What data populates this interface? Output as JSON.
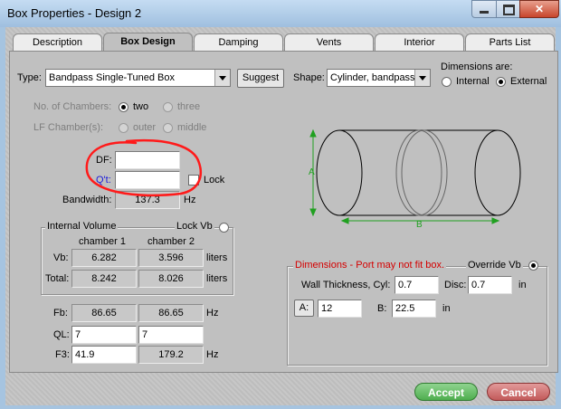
{
  "window": {
    "title": "Box Properties - Design 2",
    "close_glyph": "✕"
  },
  "tabs": [
    "Description",
    "Box Design",
    "Damping",
    "Vents",
    "Interior",
    "Parts List"
  ],
  "type": {
    "label": "Type:",
    "value": "Bandpass Single-Tuned Box",
    "suggest_label": "Suggest"
  },
  "shape": {
    "label": "Shape:",
    "value": "Cylinder, bandpass"
  },
  "dimensions_are": {
    "label": "Dimensions are:",
    "internal": "Internal",
    "external": "External",
    "selected": "External"
  },
  "chambers": {
    "label": "No. of Chambers:",
    "two": "two",
    "three": "three",
    "selected": "two"
  },
  "lf_chamber": {
    "label": "LF Chamber(s):",
    "outer": "outer",
    "middle": "middle"
  },
  "df": {
    "label": "DF:",
    "value": ""
  },
  "qt": {
    "label": "Q't:",
    "value": "",
    "lock_label": "Lock"
  },
  "bandwidth": {
    "label": "Bandwidth:",
    "value": "137.3",
    "unit": "Hz"
  },
  "internal_volume": {
    "legend": "Internal Volume",
    "lock_label": "Lock Vb",
    "col1": "chamber 1",
    "col2": "chamber 2",
    "vb_label": "Vb:",
    "vb1": "6.282",
    "vb2": "3.596",
    "vb_unit": "liters",
    "total_label": "Total:",
    "total1": "8.242",
    "total2": "8.026",
    "total_unit": "liters"
  },
  "tuning": {
    "fb_label": "Fb:",
    "fb1": "86.65",
    "fb2": "86.65",
    "fb_unit": "Hz",
    "ql_label": "QL:",
    "ql1": "7",
    "ql2": "7",
    "f3_label": "F3:",
    "f3_1": "41.9",
    "f3_2": "179.2",
    "f3_unit": "Hz"
  },
  "diagram": {
    "label_a": "A",
    "label_b": "B"
  },
  "dimensions": {
    "warning": "Dimensions - Port may not fit box.",
    "override_label": "Override Vb",
    "wall_label": "Wall Thickness, Cyl:",
    "wall_cyl": "0.7",
    "disc_label": "Disc:",
    "wall_disc": "0.7",
    "unit": "in",
    "a_label": "A:",
    "a_value": "12",
    "b_label": "B:",
    "b_value": "22.5"
  },
  "buttons": {
    "accept": "Accept",
    "cancel": "Cancel"
  },
  "colors": {
    "annotation": "#ff1a1a",
    "diagram_green": "#20a020",
    "warning_text": "#d40000",
    "qt_label": "#1a1adb",
    "accept": "#4fae4f",
    "cancel": "#c25a5a"
  }
}
